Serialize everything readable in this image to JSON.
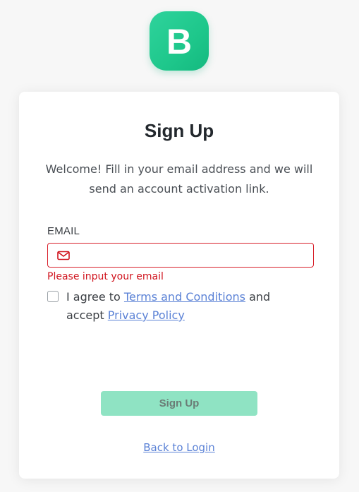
{
  "brand": {
    "logo_letter": "B",
    "logo_color": "#1fcc8e"
  },
  "card": {
    "title": "Sign Up",
    "subtitle": "Welcome! Fill in your email address and we will send an account activation link."
  },
  "form": {
    "email_label": "EMAIL",
    "email_value": "",
    "email_icon": "mail-icon",
    "email_error": "Please input your email",
    "error_color": "#d0141e",
    "agree_checked": false,
    "agree_prefix": "I agree to ",
    "terms_link": "Terms and Conditions",
    "agree_middle": " and accept ",
    "privacy_link": "Privacy Policy"
  },
  "actions": {
    "signup_label": "Sign Up",
    "signup_disabled": true,
    "signup_color": "#8fe3c3",
    "back_label": "Back to Login",
    "link_color": "#5b82d6"
  }
}
